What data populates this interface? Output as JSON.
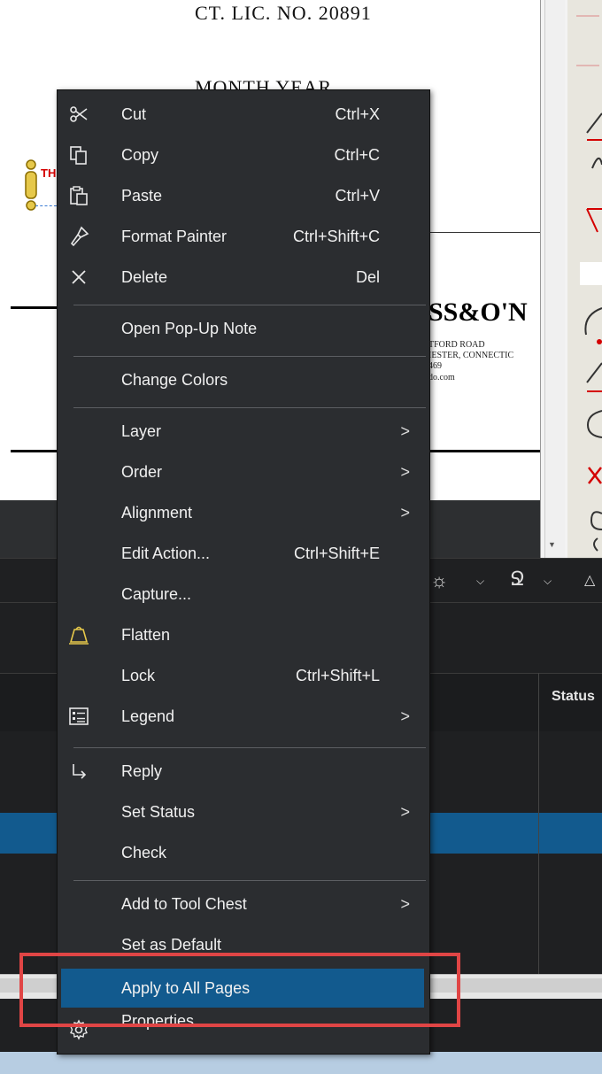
{
  "document": {
    "license_line": "CT. LIC. NO. 20891",
    "month_year": "MONTH YEAR",
    "markup_label": "TH",
    "firm_name": "SS&O'N",
    "address_line1": "TFORD ROAD",
    "address_line2": "IESTER, CONNECTIC",
    "phone_fragment": "469",
    "web_fragment": "do.com"
  },
  "table": {
    "status_header": "Status"
  },
  "context_menu": {
    "items": [
      {
        "label": "Cut",
        "shortcut": "Ctrl+X",
        "icon": "scissors-icon"
      },
      {
        "label": "Copy",
        "shortcut": "Ctrl+C",
        "icon": "copy-icon"
      },
      {
        "label": "Paste",
        "shortcut": "Ctrl+V",
        "icon": "paste-icon"
      },
      {
        "label": "Format Painter",
        "shortcut": "Ctrl+Shift+C",
        "icon": "paint-brush-icon"
      },
      {
        "label": "Delete",
        "shortcut": "Del",
        "icon": "close-icon"
      },
      {
        "label": "Open Pop-Up Note",
        "shortcut": "",
        "icon": ""
      },
      {
        "label": "Change Colors",
        "shortcut": "",
        "icon": ""
      },
      {
        "label": "Layer",
        "shortcut": "",
        "submenu": true
      },
      {
        "label": "Order",
        "shortcut": "",
        "submenu": true
      },
      {
        "label": "Alignment",
        "shortcut": "",
        "submenu": true
      },
      {
        "label": "Edit Action...",
        "shortcut": "Ctrl+Shift+E"
      },
      {
        "label": "Capture...",
        "shortcut": ""
      },
      {
        "label": "Flatten",
        "shortcut": "",
        "icon": "flatten-weight-icon"
      },
      {
        "label": "Lock",
        "shortcut": "Ctrl+Shift+L"
      },
      {
        "label": "Legend",
        "shortcut": "",
        "icon": "legend-icon",
        "submenu": true
      },
      {
        "label": "Reply",
        "shortcut": "",
        "icon": "reply-arrow-icon"
      },
      {
        "label": "Set Status",
        "shortcut": "",
        "submenu": true
      },
      {
        "label": "Check",
        "shortcut": ""
      },
      {
        "label": "Add to Tool Chest",
        "shortcut": "",
        "submenu": true
      },
      {
        "label": "Set as Default",
        "shortcut": ""
      },
      {
        "label": "Apply to All Pages",
        "shortcut": "",
        "highlighted": true
      },
      {
        "label": "Properties",
        "shortcut": "",
        "icon": "gear-icon"
      }
    ],
    "submenu_glyph": ">"
  },
  "colors": {
    "menu_bg": "#2b2d30",
    "highlight": "#125a8e",
    "callout_border": "#e04545",
    "markup_red": "#d40000"
  }
}
